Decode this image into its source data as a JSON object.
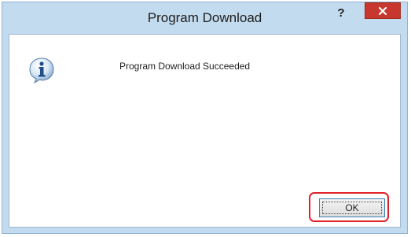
{
  "window": {
    "title": "Program Download",
    "help_label": "?",
    "close_icon": "close-icon"
  },
  "dialog": {
    "icon": "info-icon",
    "message": "Program Download Succeeded",
    "ok_label": "OK"
  },
  "colors": {
    "frame": "#c3dbef",
    "close_button": "#c7372e",
    "highlight": "#e0202a"
  }
}
